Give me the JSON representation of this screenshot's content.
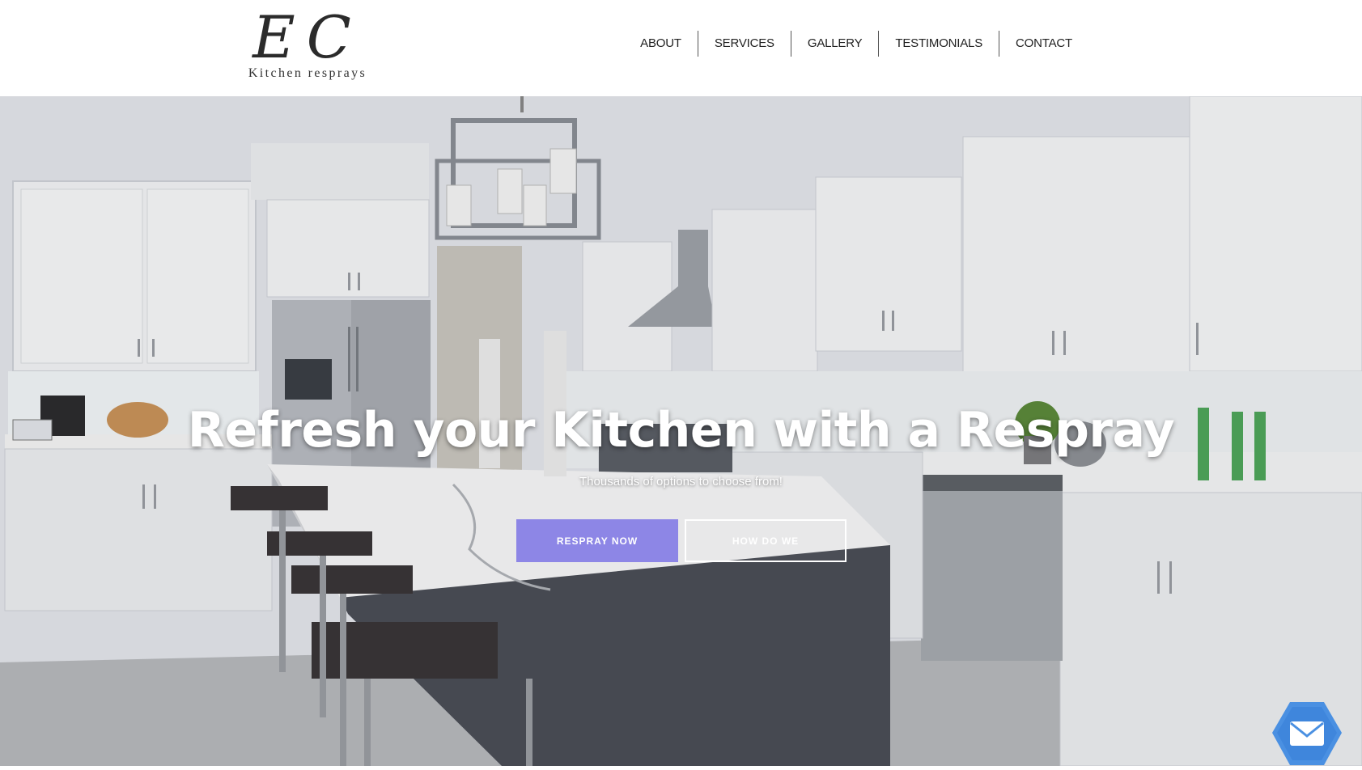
{
  "header": {
    "logo_mark": "EC",
    "logo_sub": "Kitchen resprays",
    "nav": [
      {
        "label": "ABOUT"
      },
      {
        "label": "SERVICES"
      },
      {
        "label": "GALLERY"
      },
      {
        "label": "TESTIMONIALS"
      },
      {
        "label": "CONTACT"
      }
    ]
  },
  "hero": {
    "title": "Refresh your Kitchen with a Respray",
    "subtitle": "Thousands of options to choose from!",
    "primary_button": "RESPRAY NOW",
    "secondary_button": "HOW DO WE",
    "accent_color": "#8d86e6"
  },
  "chat": {
    "icon": "envelope-icon",
    "color": "#4a90e2"
  }
}
